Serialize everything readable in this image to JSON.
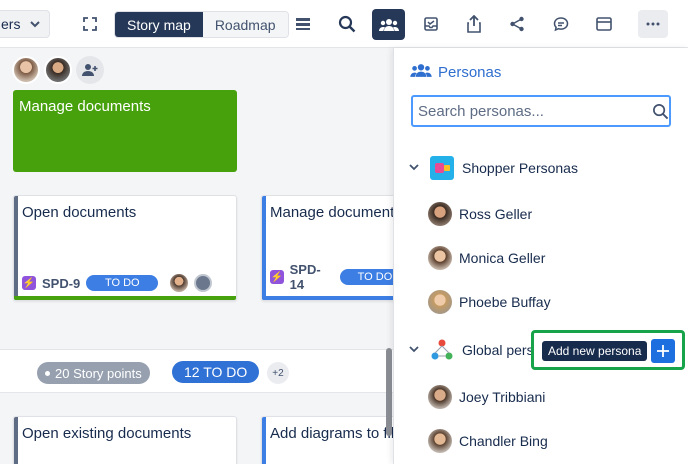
{
  "toolbar": {
    "filter_label": "ers",
    "view_story_map": "Story map",
    "view_roadmap": "Roadmap",
    "icons": [
      "chevron-down-icon",
      "fullscreen-icon",
      "rows-icon",
      "search-icon",
      "personas-icon",
      "inbox-icon",
      "share-export-icon",
      "share-icon",
      "comment-icon",
      "window-icon",
      "more-icon"
    ]
  },
  "board": {
    "cards": [
      {
        "title": "Manage documents"
      },
      {
        "title": "Open documents",
        "key": "SPD-9",
        "status": "TO DO"
      },
      {
        "title": "Manage documents",
        "key": "SPD-14",
        "status": "TO DO"
      },
      {
        "title": "Open existing documents"
      },
      {
        "title": "Add diagrams to files"
      }
    ],
    "summary": {
      "story_points": "20 Story points",
      "todo": "12 TO DO",
      "more": "+2"
    }
  },
  "panel": {
    "title": "Personas",
    "search_placeholder": "Search personas...",
    "groups": [
      {
        "name": "Shopper Personas",
        "personas": [
          "Ross Geller",
          "Monica Geller",
          "Phoebe Buffay"
        ]
      },
      {
        "name": "Global personas",
        "personas": [
          "Joey Tribbiani",
          "Chandler Bing"
        ]
      }
    ],
    "tooltip": "Add new persona"
  },
  "colors": {
    "accent": "#2f6fcf",
    "navy": "#253858",
    "green_card": "#47a10c",
    "todo": "#3d7ee4",
    "highlight": "#16a34a"
  }
}
